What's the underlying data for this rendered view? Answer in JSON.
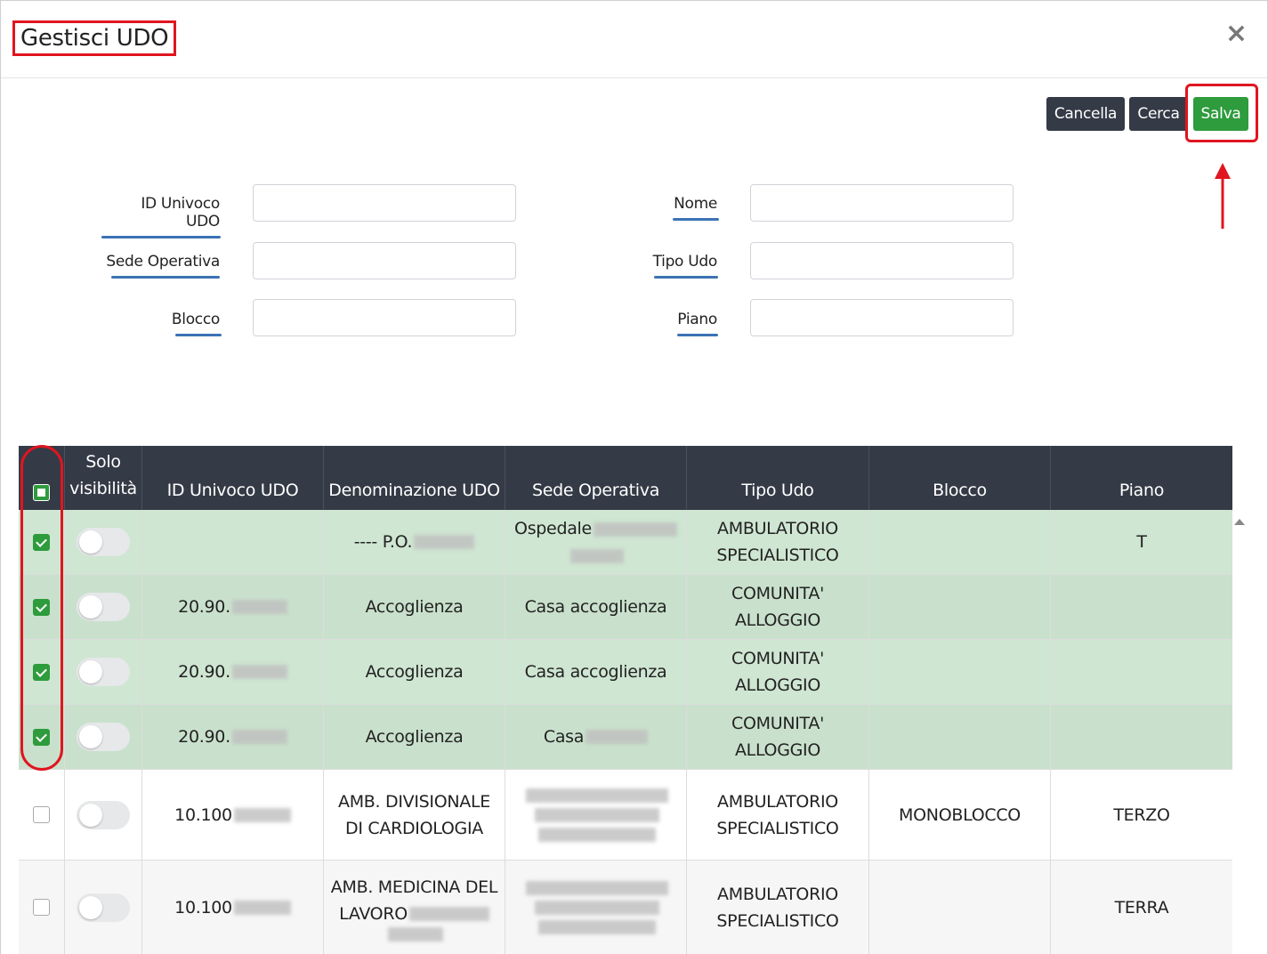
{
  "modal": {
    "title": "Gestisci UDO",
    "close_symbol": "×",
    "buttons": {
      "cancel": "Cancella",
      "search": "Cerca",
      "save": "Salva"
    }
  },
  "filters": {
    "id_univoco_udo": {
      "label": "ID Univoco UDO",
      "value": ""
    },
    "nome": {
      "label": "Nome",
      "value": ""
    },
    "sede_operativa": {
      "label": "Sede Operativa",
      "value": ""
    },
    "tipo_udo": {
      "label": "Tipo Udo",
      "value": ""
    },
    "blocco": {
      "label": "Blocco",
      "value": ""
    },
    "piano": {
      "label": "Piano",
      "value": ""
    }
  },
  "table": {
    "headers": {
      "solo_visibilita_1": "Solo",
      "solo_visibilita_2": "visibilità",
      "id": "ID Univoco UDO",
      "denominazione": "Denominazione UDO",
      "sede": "Sede Operativa",
      "tipo": "Tipo Udo",
      "blocco": "Blocco",
      "piano": "Piano"
    },
    "rows": [
      {
        "selected": true,
        "id": "",
        "denominazione": "---- P.O.",
        "sede": "Ospedale",
        "tipo_1": "AMBULATORIO",
        "tipo_2": "SPECIALISTICO",
        "blocco": "",
        "piano": "T"
      },
      {
        "selected": true,
        "id": "20.90.",
        "denominazione": "Accoglienza",
        "sede": "Casa accoglienza",
        "tipo_1": "COMUNITA'",
        "tipo_2": "ALLOGGIO",
        "blocco": "",
        "piano": ""
      },
      {
        "selected": true,
        "id": "20.90.",
        "denominazione": "Accoglienza",
        "sede": "Casa accoglienza",
        "tipo_1": "COMUNITA'",
        "tipo_2": "ALLOGGIO",
        "blocco": "",
        "piano": ""
      },
      {
        "selected": true,
        "id": "20.90.",
        "denominazione": "Accoglienza",
        "sede": "Casa",
        "tipo_1": "COMUNITA'",
        "tipo_2": "ALLOGGIO",
        "blocco": "",
        "piano": ""
      },
      {
        "selected": false,
        "id": "10.100",
        "denominazione_1": "AMB. DIVISIONALE",
        "denominazione_2": "DI CARDIOLOGIA",
        "sede": "",
        "tipo_1": "AMBULATORIO",
        "tipo_2": "SPECIALISTICO",
        "blocco": "MONOBLOCCO",
        "piano": "TERZO"
      },
      {
        "selected": false,
        "id": "10.100",
        "denominazione_1": "AMB. MEDICINA DEL",
        "denominazione_2": "LAVORO",
        "sede": "",
        "tipo_1": "AMBULATORIO",
        "tipo_2": "SPECIALISTICO",
        "blocco": "",
        "piano": "TERRA"
      }
    ]
  },
  "colors": {
    "header_bg": "#343a46",
    "selected_row": "#cfe6d2",
    "save_green": "#2e9b3d",
    "highlight_red": "#e0151f",
    "label_underline": "#3c72b4"
  },
  "icons": {
    "close": "close-icon",
    "arrow": "arrow-up-icon",
    "checkbox": "checkbox-icon",
    "toggle": "toggle-switch"
  }
}
